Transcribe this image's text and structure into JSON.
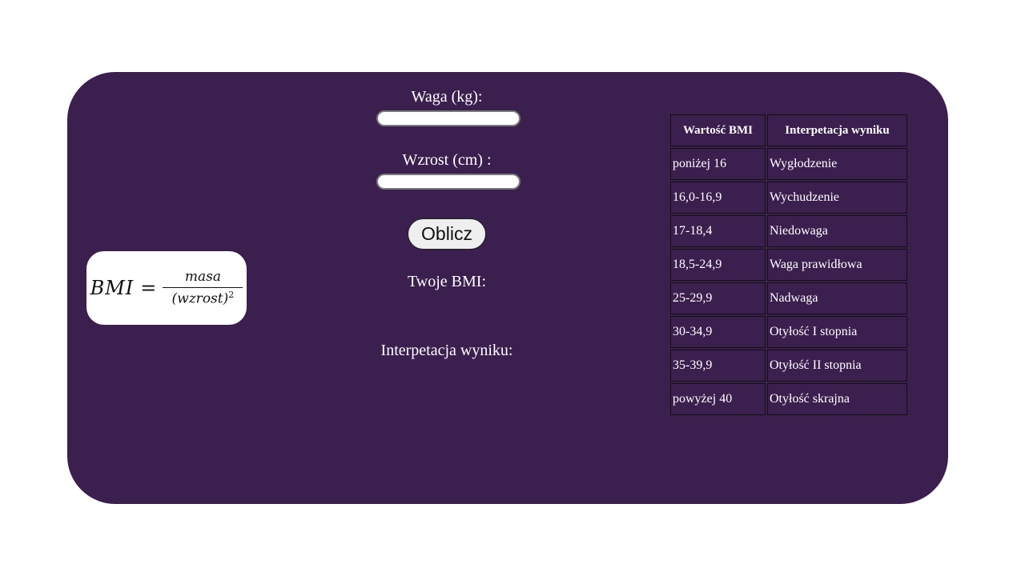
{
  "formula": {
    "lhs": "BMI",
    "eq": "=",
    "numerator": "masa",
    "denominator": "(wzrost)",
    "exponent": "2"
  },
  "form": {
    "weight_label": "Waga (kg):",
    "weight_value": "",
    "height_label": "Wzrost (cm) :",
    "height_value": "",
    "calc_button": "Oblicz",
    "result_label": "Twoje BMI:",
    "interpretation_label": "Interpetacja wyniku:"
  },
  "table": {
    "headers": [
      "Wartość BMI",
      "Interpetacja wyniku"
    ],
    "rows": [
      [
        "poniżej 16",
        "Wygłodzenie"
      ],
      [
        "16,0-16,9",
        "Wychudzenie"
      ],
      [
        "17-18,4",
        "Niedowaga"
      ],
      [
        "18,5-24,9",
        "Waga prawidłowa"
      ],
      [
        "25-29,9",
        "Nadwaga"
      ],
      [
        "30-34,9",
        "Otyłość I stopnia"
      ],
      [
        "35-39,9",
        "Otyłość II stopnia"
      ],
      [
        "powyżej 40",
        "Otyłość skrajna"
      ]
    ]
  },
  "colors": {
    "panel_bg": "#3b1f4e",
    "page_bg": "#ffffff"
  }
}
